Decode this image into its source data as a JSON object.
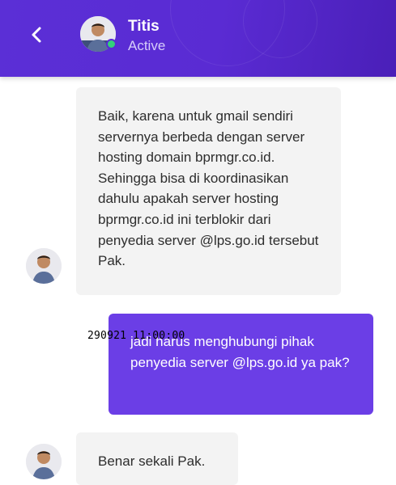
{
  "header": {
    "contact_name": "Titis",
    "contact_status": "Active",
    "accent_color": "#5a2bd3",
    "online_color": "#33d17a"
  },
  "messages": [
    {
      "direction": "incoming",
      "text": "Baik, karena untuk gmail sendiri servernya berbeda dengan server hosting domain bprmgr.co.id. Sehingga bisa di koordinasikan dahulu apakah server hosting bprmgr.co.id ini terblokir dari penyedia server @lps.go.id tersebut Pak."
    },
    {
      "direction": "outgoing",
      "text": "jadi harus menghubungi pihak penyedia server @lps.go.id ya pak?"
    },
    {
      "direction": "incoming",
      "text": "Benar sekali Pak."
    }
  ],
  "overlay_stamp": "290921 11:00:00",
  "icons": {
    "back": "chevron-left-icon",
    "avatar": "avatar-icon"
  }
}
